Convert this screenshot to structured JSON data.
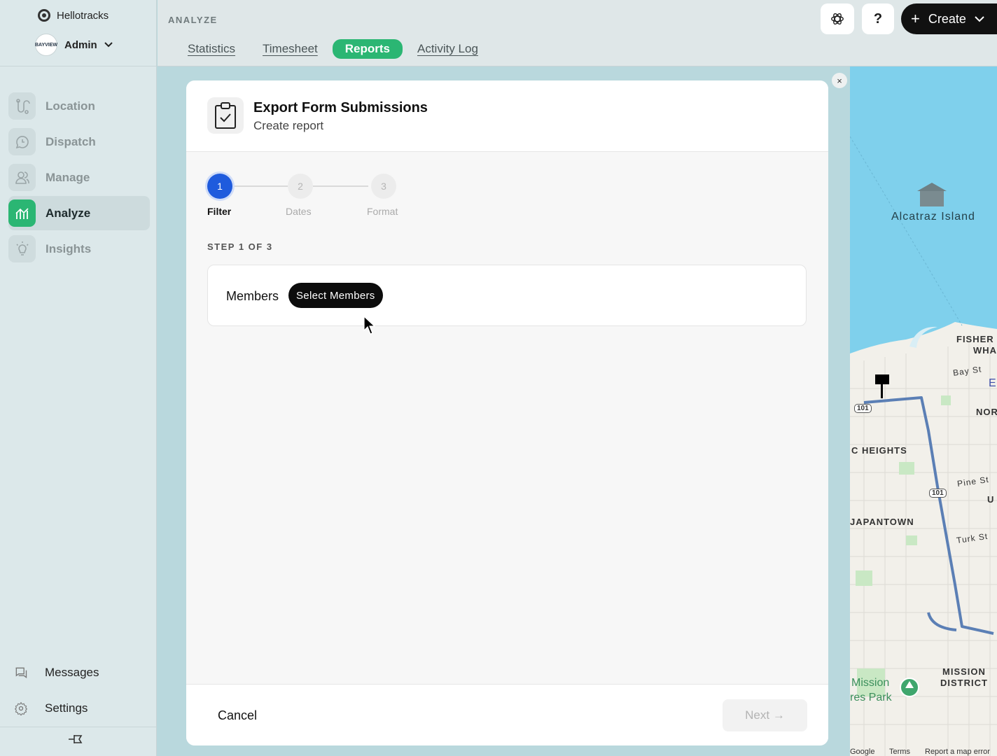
{
  "app": {
    "brand": "Hellotracks",
    "user": "Admin",
    "avatar_text": "BAYVIEW"
  },
  "nav": {
    "items": [
      {
        "label": "Location",
        "icon": "route-icon"
      },
      {
        "label": "Dispatch",
        "icon": "chat-clock-icon"
      },
      {
        "label": "Manage",
        "icon": "users-icon"
      },
      {
        "label": "Analyze",
        "icon": "chart-icon",
        "active": true
      },
      {
        "label": "Insights",
        "icon": "lightbulb-icon"
      }
    ],
    "messages": "Messages",
    "settings": "Settings"
  },
  "header": {
    "section": "ANALYZE",
    "tabs": [
      "Statistics",
      "Timesheet",
      "Reports",
      "Activity Log"
    ],
    "active_tab": "Reports",
    "help": "?",
    "create": "Create"
  },
  "modal": {
    "title": "Export Form Submissions",
    "subtitle": "Create report",
    "steps": [
      {
        "num": "1",
        "label": "Filter"
      },
      {
        "num": "2",
        "label": "Dates"
      },
      {
        "num": "3",
        "label": "Format"
      }
    ],
    "step_count": "STEP 1 OF 3",
    "members_label": "Members",
    "select_members": "Select Members",
    "cancel": "Cancel",
    "next": "Next →",
    "close": "×"
  },
  "map": {
    "labels": {
      "alcatraz": "Alcatraz Island",
      "fisherman_1": "FISHER",
      "fisherman_2": "WHA",
      "bay_st": "Bay St",
      "e": "E",
      "north": "NOR",
      "heights": "C HEIGHTS",
      "pine": "Pine St",
      "u": "U",
      "japantown": "JAPANTOWN",
      "turk": "Turk St",
      "mission_dolores_1": "Mission",
      "mission_dolores_2": "res Park",
      "mission_district_1": "MISSION",
      "mission_district_2": "DISTRICT",
      "hwy_101": "101",
      "footer_google": "Google",
      "footer_terms": "Terms",
      "footer_report": "Report a map error"
    },
    "colors": {
      "water": "#7fd0ec",
      "land": "#f2f0ea",
      "route": "#5b7fb5"
    }
  }
}
